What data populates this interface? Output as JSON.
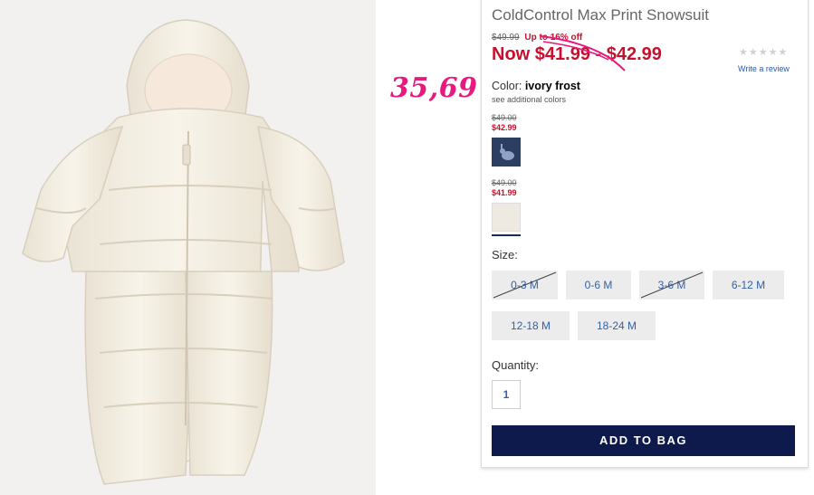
{
  "product": {
    "title": "ColdControl Max Print Snowsuit",
    "original_price": "$49.99",
    "promo_text": "Up to 16% off",
    "now_price": "Now $41.99 - $42.99",
    "rating_stars": "★★★★★",
    "review_link": "Write a review"
  },
  "annotation": {
    "handwritten_price": "35,69",
    "color": "#e8187e"
  },
  "color": {
    "label": "Color:",
    "selected": "ivory frost",
    "see_more": "see additional colors",
    "swatches": [
      {
        "name": "navy print",
        "old_price": "$49.00",
        "new_price": "$42.99",
        "color": "#2c3e62"
      },
      {
        "name": "ivory frost",
        "old_price": "$49.00",
        "new_price": "$41.99",
        "color": "#efeae1",
        "selected": true
      }
    ]
  },
  "size": {
    "label": "Size:",
    "options": [
      {
        "label": "0-3 M",
        "available": false
      },
      {
        "label": "0-6 M",
        "available": true
      },
      {
        "label": "3-6 M",
        "available": false
      },
      {
        "label": "6-12 M",
        "available": true
      },
      {
        "label": "12-18 M",
        "available": true
      },
      {
        "label": "18-24 M",
        "available": true
      }
    ]
  },
  "quantity": {
    "label": "Quantity:",
    "value": "1"
  },
  "actions": {
    "add_to_bag": "ADD TO BAG"
  },
  "colors": {
    "sale_red": "#c8102e",
    "link_blue": "#3460a8",
    "button_navy": "#0e1a4b"
  }
}
